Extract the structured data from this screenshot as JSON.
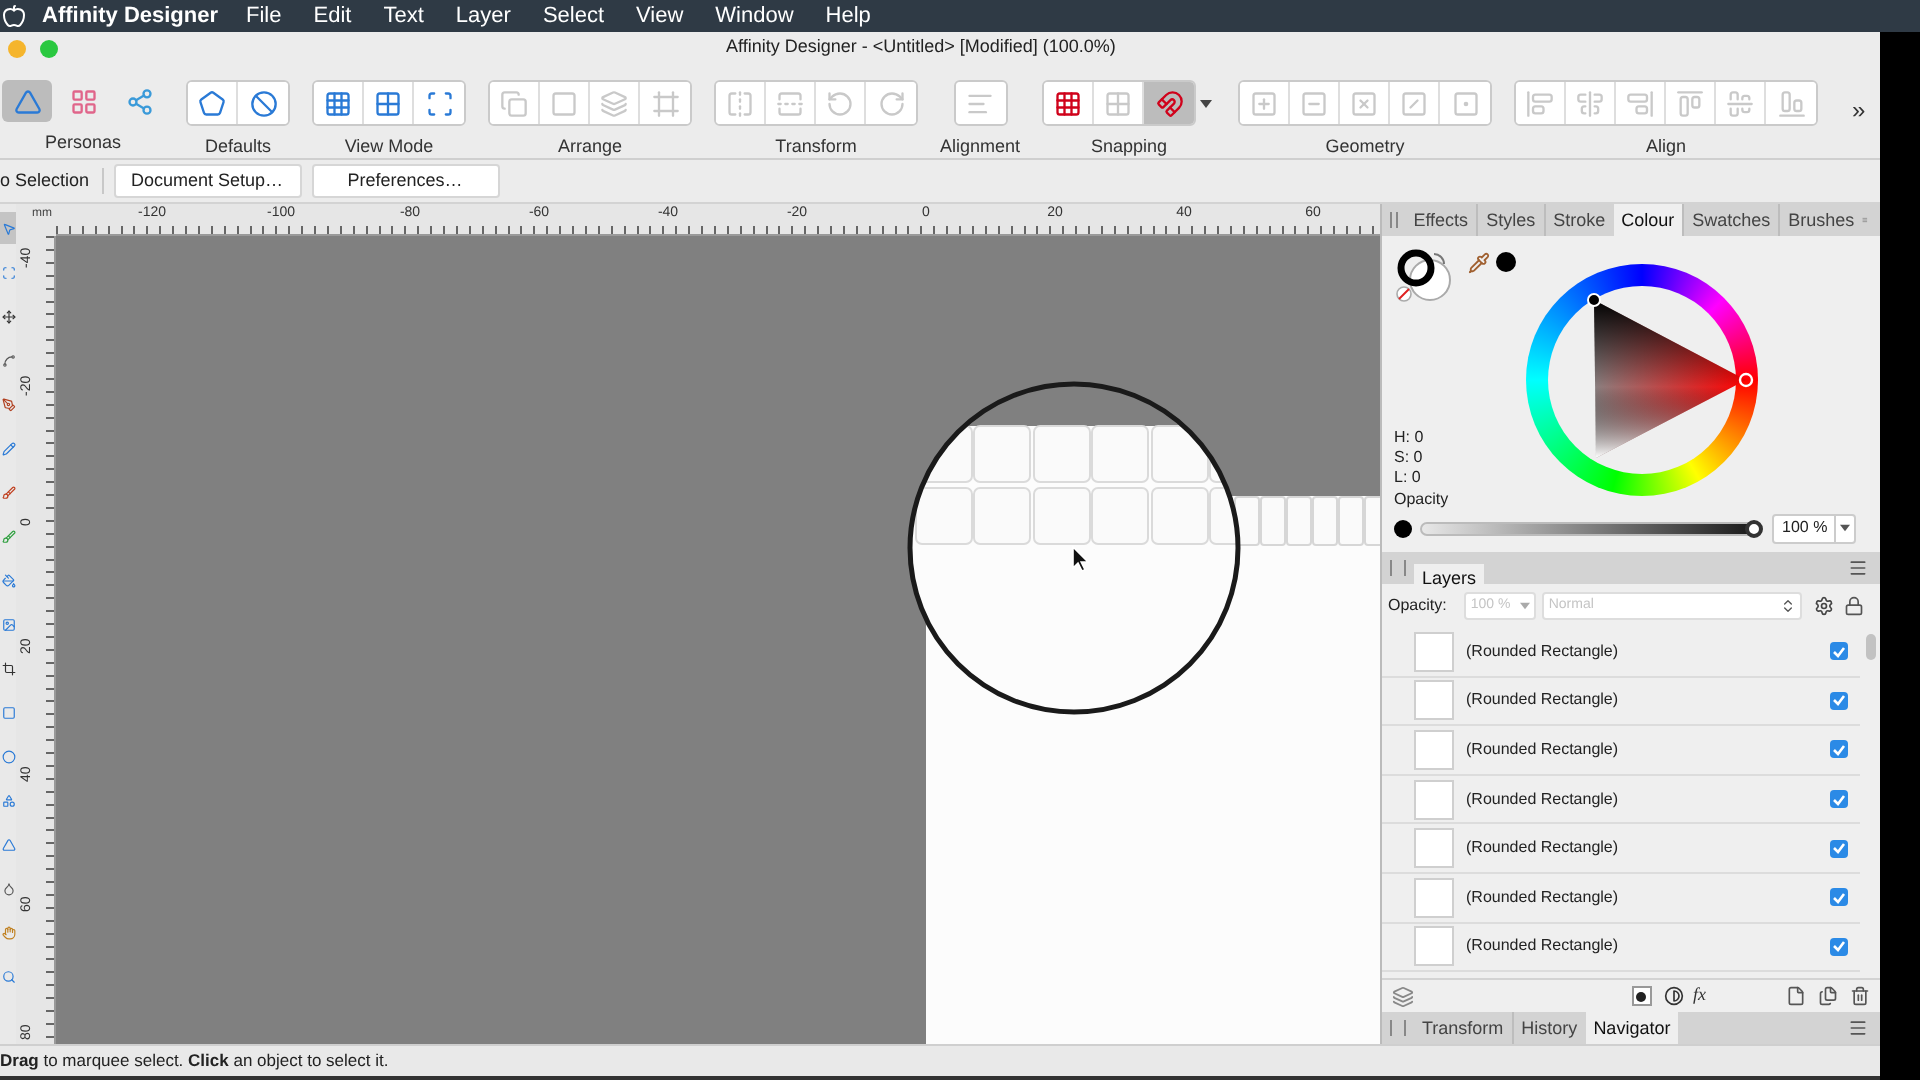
{
  "menu_bar": {
    "app_name": "Affinity Designer",
    "items": [
      "File",
      "Edit",
      "Text",
      "Layer",
      "Select",
      "View",
      "Window",
      "Help"
    ]
  },
  "window": {
    "title": "Affinity Designer - <Untitled> [Modified] (100.0%)"
  },
  "toolbar": {
    "groups": [
      {
        "label": "Personas",
        "kind": "personas",
        "buttons": [
          {
            "selected": true,
            "disabled": false
          },
          {
            "selected": false,
            "disabled": false
          },
          {
            "selected": false,
            "disabled": false
          }
        ]
      },
      {
        "label": "Defaults",
        "kind": "defaults",
        "buttons": [
          {
            "selected": false,
            "disabled": false
          },
          {
            "selected": false,
            "disabled": false
          }
        ]
      },
      {
        "label": "View Mode",
        "kind": "view_mode",
        "buttons": [
          {
            "selected": false,
            "disabled": false
          },
          {
            "selected": false,
            "disabled": false
          },
          {
            "selected": false,
            "disabled": false
          }
        ]
      },
      {
        "label": "Arrange",
        "kind": "arrange",
        "buttons": [
          {
            "selected": false,
            "disabled": true
          },
          {
            "selected": false,
            "disabled": true
          },
          {
            "selected": false,
            "disabled": true
          },
          {
            "selected": false,
            "disabled": true
          }
        ]
      },
      {
        "label": "Transform",
        "kind": "transform",
        "buttons": [
          {
            "selected": false,
            "disabled": true
          },
          {
            "selected": false,
            "disabled": true
          },
          {
            "selected": false,
            "disabled": true
          },
          {
            "selected": false,
            "disabled": true
          }
        ]
      },
      {
        "label": "Alignment",
        "kind": "alignment",
        "buttons": [
          {
            "selected": false,
            "disabled": true
          }
        ]
      },
      {
        "label": "Snapping",
        "kind": "snapping",
        "dropdown": true,
        "buttons": [
          {
            "selected": false,
            "disabled": false
          },
          {
            "selected": false,
            "disabled": true
          },
          {
            "selected": true,
            "disabled": false
          }
        ]
      },
      {
        "label": "Geometry",
        "kind": "geometry",
        "buttons": [
          {
            "selected": false,
            "disabled": true
          },
          {
            "selected": false,
            "disabled": true
          },
          {
            "selected": false,
            "disabled": true
          },
          {
            "selected": false,
            "disabled": true
          },
          {
            "selected": false,
            "disabled": true
          }
        ]
      },
      {
        "label": "Align",
        "kind": "align",
        "buttons": [
          {
            "selected": false,
            "disabled": true
          },
          {
            "selected": false,
            "disabled": true
          },
          {
            "selected": false,
            "disabled": true
          },
          {
            "selected": false,
            "disabled": true
          },
          {
            "selected": false,
            "disabled": true
          },
          {
            "selected": false,
            "disabled": true
          }
        ]
      }
    ],
    "overflow": "»"
  },
  "context_bar": {
    "label": "o Selection",
    "buttons": [
      "Document Setup…",
      "Preferences…"
    ]
  },
  "tools": [
    {
      "selected": true
    },
    {
      "selected": false
    },
    {
      "selected": false
    },
    {
      "selected": false
    },
    {
      "selected": false
    },
    {
      "selected": false
    },
    {
      "selected": false
    },
    {
      "selected": false
    },
    {
      "selected": false
    },
    {
      "selected": false
    },
    {
      "selected": false
    },
    {
      "selected": false
    },
    {
      "selected": false
    },
    {
      "selected": false
    },
    {
      "selected": false
    },
    {
      "selected": false
    },
    {
      "selected": false
    },
    {
      "selected": false
    }
  ],
  "rulers": {
    "unit": "mm",
    "horizontal": [
      "-120",
      "-100",
      "-80",
      "-60",
      "-40",
      "-20",
      "0",
      "20",
      "40",
      "60"
    ],
    "vertical": [
      "-40",
      "-20",
      "0",
      "20",
      "40",
      "60",
      "80"
    ]
  },
  "colour_panel": {
    "tabs": [
      {
        "label": "Effects",
        "selected": false
      },
      {
        "label": "Styles",
        "selected": false
      },
      {
        "label": "Stroke",
        "selected": false
      },
      {
        "label": "Colour",
        "selected": true
      },
      {
        "label": "Swatches",
        "selected": false
      },
      {
        "label": "Brushes",
        "selected": false
      }
    ],
    "hsl": [
      "H: 0",
      "S: 0",
      "L: 0"
    ],
    "opacity_label": "Opacity",
    "opacity": {
      "level": 1,
      "value": "100 %"
    }
  },
  "layers_panel": {
    "tab": "Layers",
    "opacity_label": "Opacity:",
    "opacity_value": "100 %",
    "blend_mode": "Normal",
    "controls_disabled": true,
    "fx": "fx",
    "layers": [
      {
        "name": "(Rounded Rectangle)",
        "visible": true
      },
      {
        "name": "(Rounded Rectangle)",
        "visible": true
      },
      {
        "name": "(Rounded Rectangle)",
        "visible": true
      },
      {
        "name": "(Rounded Rectangle)",
        "visible": true
      },
      {
        "name": "(Rounded Rectangle)",
        "visible": true
      },
      {
        "name": "(Rounded Rectangle)",
        "visible": true
      },
      {
        "name": "(Rounded Rectangle)",
        "visible": true
      }
    ]
  },
  "bottom_tabs": [
    {
      "label": "Transform",
      "selected": false
    },
    {
      "label": "History",
      "selected": false
    },
    {
      "label": "Navigator",
      "selected": true
    }
  ],
  "status_bar": "**Drag** to marquee select. **Click** an object to select it."
}
